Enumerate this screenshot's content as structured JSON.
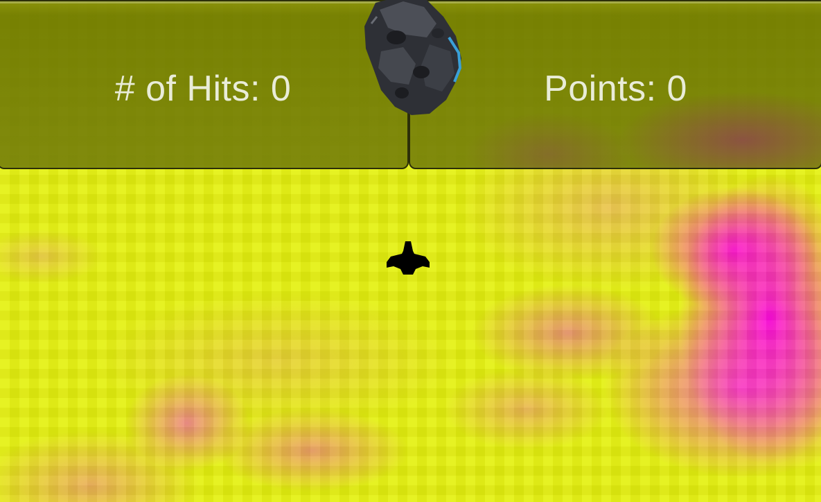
{
  "game": {
    "title": "",
    "hud": {
      "hits_label": "# of Hits: 0",
      "points_label": "Points: 0"
    },
    "entities": {
      "asteroid_icon": "asteroid-icon",
      "player_icon": "spaceship-icon"
    },
    "colors": {
      "background_primary": "#e4f00e",
      "background_accent": "#ff00e0",
      "hud_panel": "#6c7600",
      "hud_text": "#e9ecd8",
      "ship": "#000000"
    }
  }
}
